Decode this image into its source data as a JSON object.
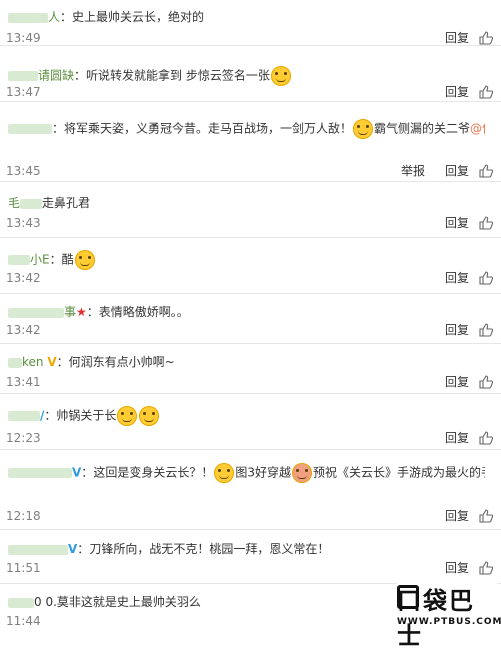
{
  "comments": [
    {
      "user": "人",
      "text": "史上最帅关云长，绝对的",
      "time": "13:49",
      "actions": [
        "回复"
      ]
    },
    {
      "user": "请圆缺",
      "text": "听说转发就能拿到 步惊云签名一张",
      "time": "13:47",
      "actions": [
        "回复"
      ]
    },
    {
      "user": "",
      "text": "将军乘天姿，义勇冠今昔。走马百战场，一剑万人敌！",
      "text2": "霸气侧漏的关二爷",
      "mention": "@何润",
      "time": "13:45",
      "actions": [
        "举报",
        "回复"
      ]
    },
    {
      "user": "毛",
      "text": "走鼻孔君",
      "time": "13:43",
      "actions": [
        "回复"
      ]
    },
    {
      "user": "小E",
      "text": "酷",
      "time": "13:42",
      "actions": [
        "回复"
      ]
    },
    {
      "user": "事",
      "text": "表情略傲娇啊。。",
      "time": "13:42",
      "actions": [
        "回复"
      ]
    },
    {
      "user": "ken",
      "text": "何润东有点小帅啊~",
      "time": "13:41",
      "actions": [
        "回复"
      ]
    },
    {
      "user": "",
      "text": "帅锅关于长",
      "time": "12:23",
      "actions": [
        "回复"
      ]
    },
    {
      "user": "",
      "text": "这回是变身关云长？！",
      "text2": "图3好穿越",
      "text3": "预祝《关云长》手游成为最火的手",
      "time": "12:18",
      "actions": [
        "回复"
      ]
    },
    {
      "user": "",
      "text": "刀锋所向，战无不克！桃园一拜，恩义常在！",
      "time": "11:51",
      "actions": [
        "回复"
      ]
    },
    {
      "user": "0 0.",
      "text": "莫非这就是史上最帅关羽么",
      "time": "11:44",
      "actions": []
    }
  ],
  "icons": {
    "like": "thumbs-up-icon",
    "emoji": "laughing-face-icon"
  },
  "watermark": {
    "main": "口袋巴士",
    "url": "WWW.PTBUS.COM"
  },
  "colors": {
    "username": "#5a8f3e",
    "mention": "#eb7350",
    "time": "#808080",
    "verified_gold": "#f0a800",
    "verified_blue": "#2e9be0"
  }
}
